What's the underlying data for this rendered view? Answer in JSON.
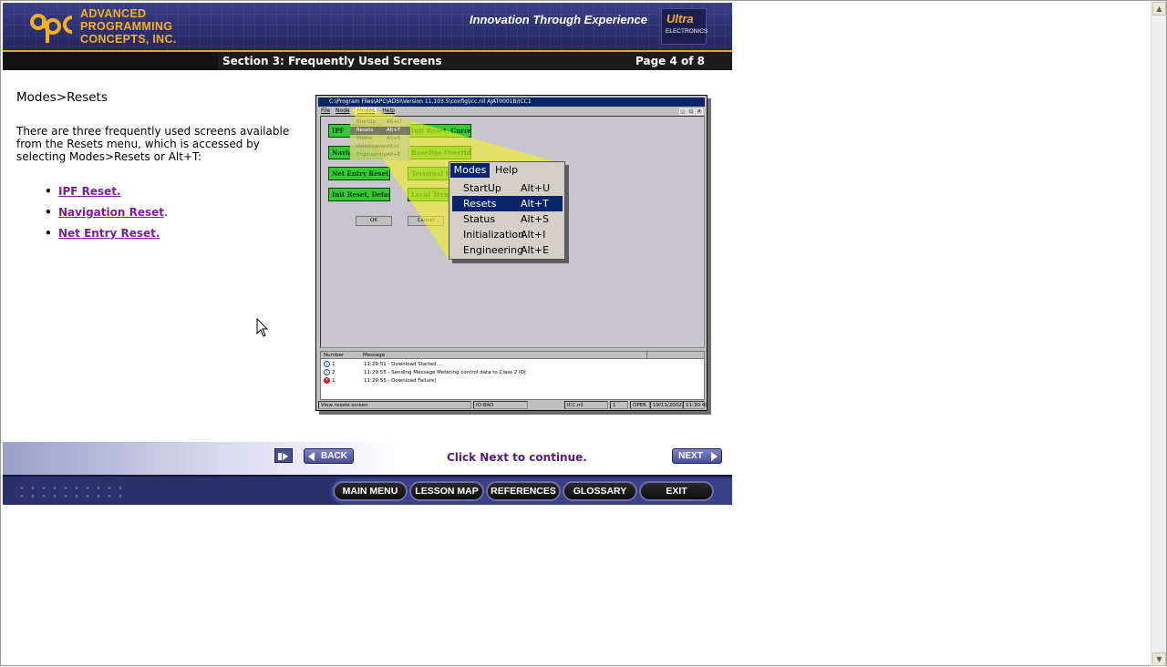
{
  "header": {
    "company_lines": [
      "ADVANCED",
      "PROGRAMMING",
      "CONCEPTS, INC."
    ],
    "logo_letters": "apc",
    "tagline": "Innovation Through Experience",
    "partner_logo": {
      "name": "Ultra",
      "sub": "ELECTRONICS"
    },
    "accent_color": "#f2b125"
  },
  "titlebar": {
    "section_title": "Section 3: Frequently Used Screens",
    "page_indicator": "Page 4 of 8"
  },
  "content": {
    "title": "Modes>Resets",
    "paragraph": "There are three frequently used screens available from the Resets menu, which is accessed by selecting Modes>Resets or Alt+T:",
    "links": [
      {
        "label": "IPF Reset.",
        "suffix": ""
      },
      {
        "label": "Navigation Reset",
        "suffix": "."
      },
      {
        "label": "Net Entry Reset.",
        "suffix": ""
      }
    ],
    "link_color": "#7a1f9a"
  },
  "screenshot": {
    "window_title": "C:\\Program Files\\APC\\ADSI\\Version 11.103.5\\config\\icc.nil  AJAT0001B/ICC1",
    "window_buttons": [
      "_",
      "□",
      "x"
    ],
    "menubar": [
      "File",
      "Node",
      "Modes",
      "Help"
    ],
    "active_menu": "Modes",
    "mini_menu": [
      {
        "label": "StartUp",
        "accel": "Alt+U"
      },
      {
        "label": "Resets",
        "accel": "Alt+T"
      },
      {
        "label": "Status",
        "accel": "Alt+S"
      },
      {
        "label": "Initialization",
        "accel": "Alt+I"
      },
      {
        "label": "Engineering",
        "accel": "Alt+E"
      }
    ],
    "green_buttons": [
      "IPF",
      "Init Reset, Current",
      "Navig",
      "Baseline Override",
      "Net Entry Reset",
      "Terminal Ke",
      "Init Reset, Default",
      "Local Term S"
    ],
    "ok_label": "OK",
    "cancel_label": "Cancel",
    "log": {
      "columns": [
        "Number",
        "Message"
      ],
      "rows": [
        {
          "type": "info",
          "number": "1",
          "message": "11:29:51 - Download Started..."
        },
        {
          "type": "info",
          "number": "2",
          "message": "11:29:55 - Sending Message Metering control data to Class 2 IO|"
        },
        {
          "type": "error",
          "number": "1",
          "message": "11:29:55 - Download Failure|"
        }
      ]
    },
    "status_bar": [
      "View resets screen",
      "IO BAD",
      "ICC.nil",
      "1",
      "OPER",
      "19/11/2002",
      "11:30:40"
    ]
  },
  "zoom_menu": {
    "bar": [
      "Modes",
      "Help"
    ],
    "items": [
      {
        "label": "StartUp",
        "accel": "Alt+U",
        "selected": false
      },
      {
        "label": "Resets",
        "accel": "Alt+T",
        "selected": true
      },
      {
        "label": "Status",
        "accel": "Alt+S",
        "selected": false
      },
      {
        "label": "Initialization",
        "accel": "Alt+I",
        "selected": false
      },
      {
        "label": "Engineering",
        "accel": "Alt+E",
        "selected": false
      }
    ]
  },
  "navigation": {
    "back_label": "BACK",
    "next_label": "NEXT",
    "continue_text": "Click Next to continue."
  },
  "menu": {
    "items": [
      "MAIN MENU",
      "LESSON MAP",
      "REFERENCES",
      "GLOSSARY",
      "EXIT"
    ]
  }
}
